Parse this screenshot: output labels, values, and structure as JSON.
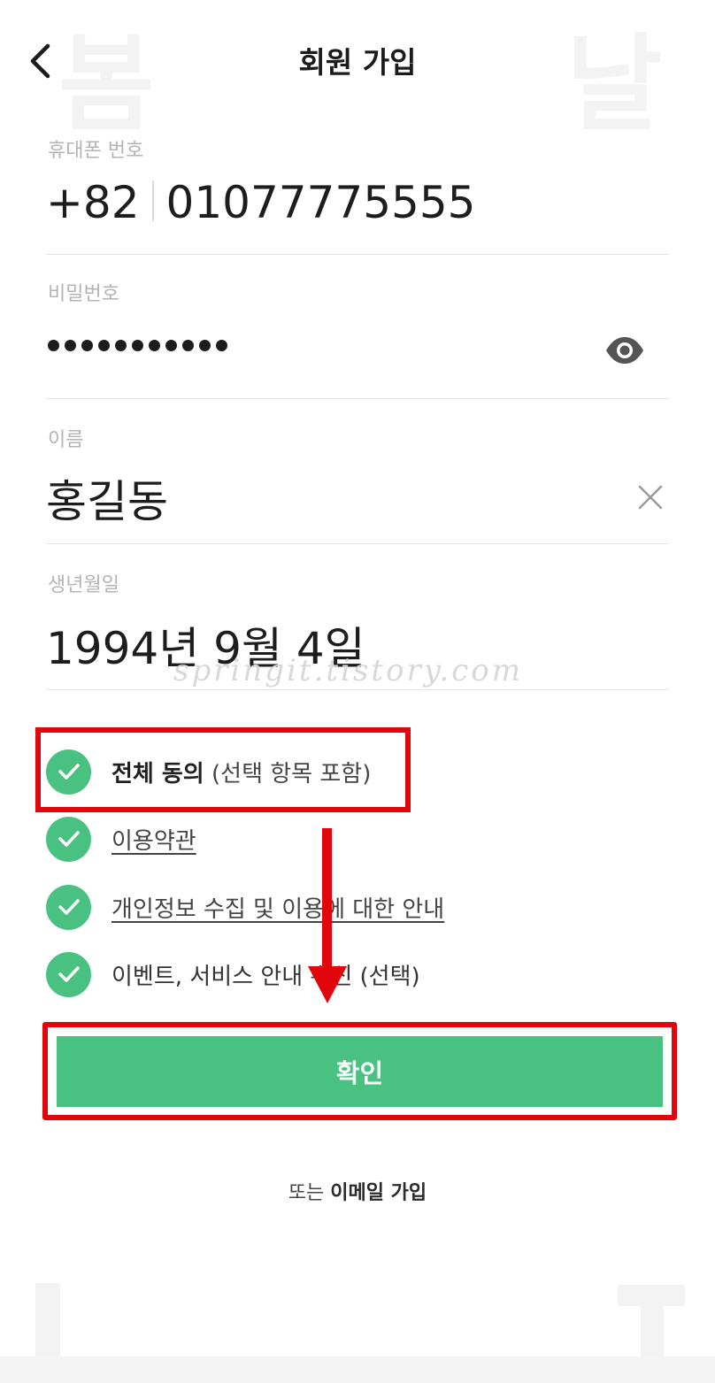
{
  "header": {
    "title": "회원 가입",
    "back_icon": "chevron-left-icon"
  },
  "watermark": {
    "top_left": "봄",
    "top_right": "날",
    "url": "springit.tistory.com"
  },
  "form": {
    "phone": {
      "label": "휴대폰 번호",
      "country_code": "+82",
      "number": "01077775555"
    },
    "password": {
      "label": "비밀번호",
      "masked_length": 11,
      "toggle_icon": "eye-icon"
    },
    "name": {
      "label": "이름",
      "value": "홍길동",
      "clear_icon": "close-icon"
    },
    "birthdate": {
      "label": "생년월일",
      "value": "1994년 9월 4일"
    }
  },
  "agreements": {
    "all": {
      "label_strong": "전체 동의",
      "label_sub": "(선택 항목 포함)",
      "checked": true
    },
    "items": [
      {
        "label": "이용약관",
        "checked": true,
        "link": true
      },
      {
        "label": "개인정보 수집 및 이용에 대한 안내",
        "checked": true,
        "link": true
      },
      {
        "label": "이벤트, 서비스 안내 수신 (선택)",
        "checked": true,
        "link": false
      }
    ]
  },
  "confirm_button": {
    "label": "확인"
  },
  "email_signup": {
    "prefix": "또는",
    "link_label": "이메일 가입"
  },
  "colors": {
    "accent_green": "#49c281",
    "highlight_red": "#e1060b"
  }
}
